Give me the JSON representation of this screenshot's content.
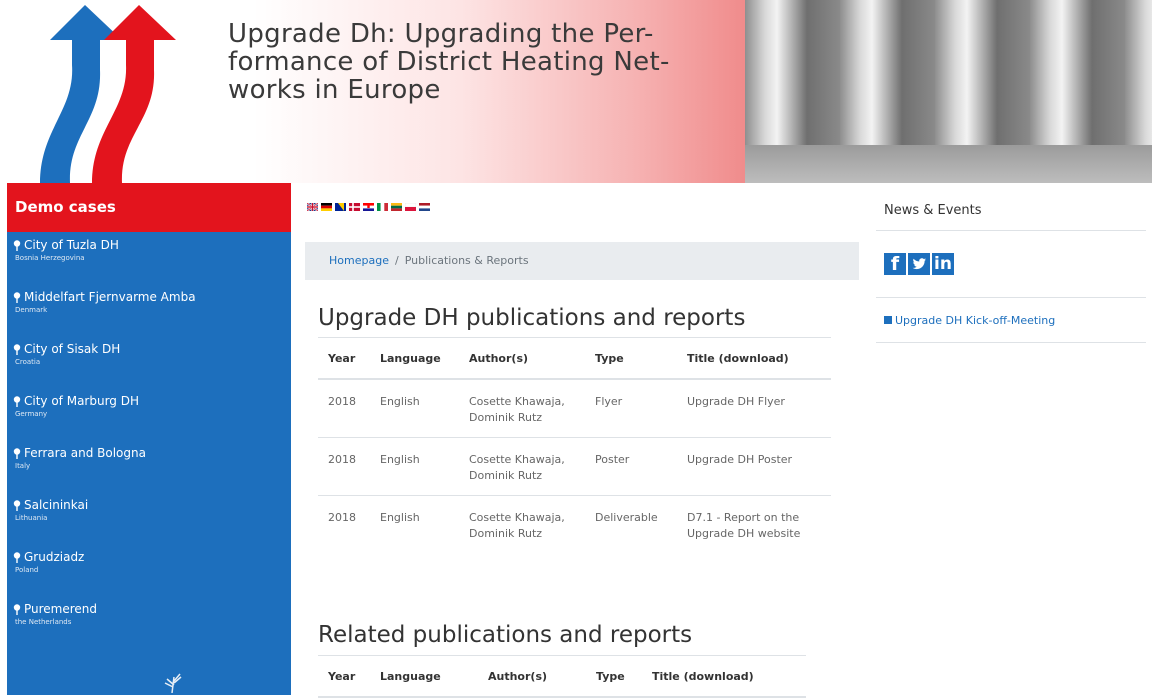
{
  "header": {
    "title": "Upgrade Dh: Upgrading the Per- formance of District Heating Net- works in Europe"
  },
  "colors": {
    "brand_blue": "#1d6fbd",
    "brand_red": "#e3141d",
    "breadcrumb_bg": "#e9ecef"
  },
  "sidebar": {
    "heading": "Demo cases",
    "items": [
      {
        "name": "City of Tuzla DH",
        "country": "Bosnia Herzegovina"
      },
      {
        "name": "Middelfart Fjernvarme Amba",
        "country": "Denmark"
      },
      {
        "name": "City of Sisak DH",
        "country": "Croatia"
      },
      {
        "name": "City of Marburg DH",
        "country": "Germany"
      },
      {
        "name": "Ferrara and Bologna",
        "country": "Italy"
      },
      {
        "name": "Salcininkai",
        "country": "Lithuania"
      },
      {
        "name": "Grudziadz",
        "country": "Poland"
      },
      {
        "name": "Puremerend",
        "country": "the Netherlands"
      }
    ]
  },
  "language_flags": [
    "uk-flag",
    "germany-flag",
    "bosnia-flag",
    "denmark-flag",
    "croatia-flag",
    "italy-flag",
    "lithuania-flag",
    "poland-flag",
    "netherlands-flag"
  ],
  "breadcrumb": {
    "home": "Homepage",
    "separator": "/",
    "current": "Publications & Reports"
  },
  "main": {
    "section1_title": "Upgrade DH publications and reports",
    "section2_title": "Related publications and reports",
    "table_headers": [
      "Year",
      "Language",
      "Author(s)",
      "Type",
      "Title (download)"
    ],
    "rows": [
      {
        "year": "2018",
        "language": "English",
        "author1": "Cosette Khawaja,",
        "author2": "Dominik Rutz",
        "type": "Flyer",
        "title1": "Upgrade DH Flyer",
        "title2": ""
      },
      {
        "year": "2018",
        "language": "English",
        "author1": "Cosette Khawaja,",
        "author2": "Dominik Rutz",
        "type": "Poster",
        "title1": "Upgrade DH Poster",
        "title2": ""
      },
      {
        "year": "2018",
        "language": "English",
        "author1": "Cosette Khawaja,",
        "author2": "Dominik Rutz",
        "type": "Deliverable",
        "title1": "D7.1 - Report on the",
        "title2": "Upgrade DH website"
      }
    ]
  },
  "news": {
    "title": "News & Events",
    "social": [
      "facebook-icon",
      "twitter-icon",
      "linkedin-icon"
    ],
    "event": "Upgrade DH Kick-off-Meeting"
  }
}
